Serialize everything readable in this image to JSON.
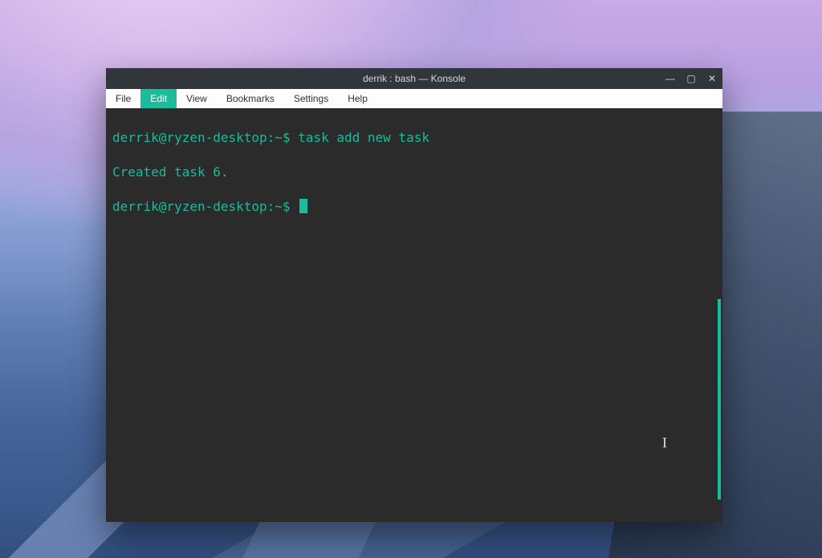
{
  "window": {
    "title": "derrik : bash — Konsole"
  },
  "menubar": {
    "items": [
      {
        "label": "File",
        "active": false
      },
      {
        "label": "Edit",
        "active": true
      },
      {
        "label": "View",
        "active": false
      },
      {
        "label": "Bookmarks",
        "active": false
      },
      {
        "label": "Settings",
        "active": false
      },
      {
        "label": "Help",
        "active": false
      }
    ]
  },
  "terminal": {
    "lines": [
      {
        "prompt": "derrik@ryzen-desktop:~$",
        "command": "task add new task"
      },
      {
        "output": "Created task 6."
      },
      {
        "prompt": "derrik@ryzen-desktop:~$",
        "command": "",
        "cursor": true
      }
    ]
  },
  "colors": {
    "accent": "#1abc9c",
    "term_bg": "#2b2b2b",
    "titlebar_bg": "#31363b",
    "menubar_bg": "#fdfdfd"
  }
}
